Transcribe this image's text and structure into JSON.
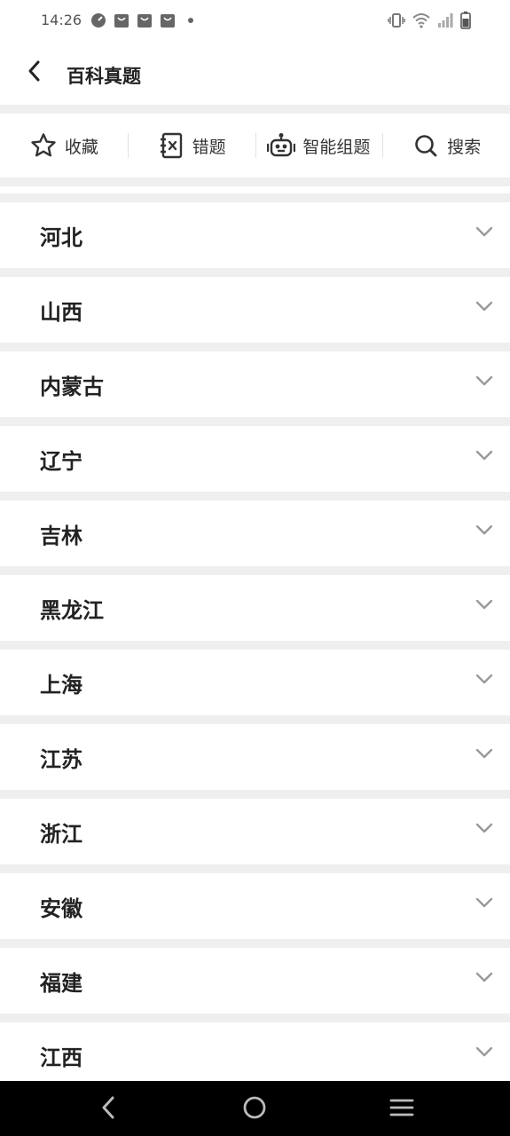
{
  "status_bar": {
    "time": "14:26",
    "left_icons": [
      "speedometer-icon",
      "bag-icon",
      "bag-icon",
      "bag-icon",
      "dot-icon"
    ],
    "right_icons": [
      "vibrate-icon",
      "wifi-icon",
      "signal-icon",
      "battery-icon"
    ]
  },
  "app_bar": {
    "title": "百科真题",
    "back_icon": "chevron-left-icon"
  },
  "toolbar": {
    "items": [
      {
        "label": "收藏",
        "icon": "star-icon"
      },
      {
        "label": "错题",
        "icon": "wrong-notebook-icon"
      },
      {
        "label": "智能组题",
        "icon": "robot-icon"
      },
      {
        "label": "搜索",
        "icon": "search-icon"
      }
    ]
  },
  "provinces": [
    {
      "label": "河北"
    },
    {
      "label": "山西"
    },
    {
      "label": "内蒙古"
    },
    {
      "label": "辽宁"
    },
    {
      "label": "吉林"
    },
    {
      "label": "黑龙江"
    },
    {
      "label": "上海"
    },
    {
      "label": "江苏"
    },
    {
      "label": "浙江"
    },
    {
      "label": "安徽"
    },
    {
      "label": "福建"
    },
    {
      "label": "江西"
    }
  ],
  "nav_bar": {
    "buttons": [
      "back-nav-icon",
      "home-nav-icon",
      "menu-nav-icon"
    ]
  },
  "colors": {
    "background": "#efefef",
    "surface": "#ffffff",
    "text": "#222222",
    "chevron": "#999999",
    "nav_bar": "#000000"
  }
}
